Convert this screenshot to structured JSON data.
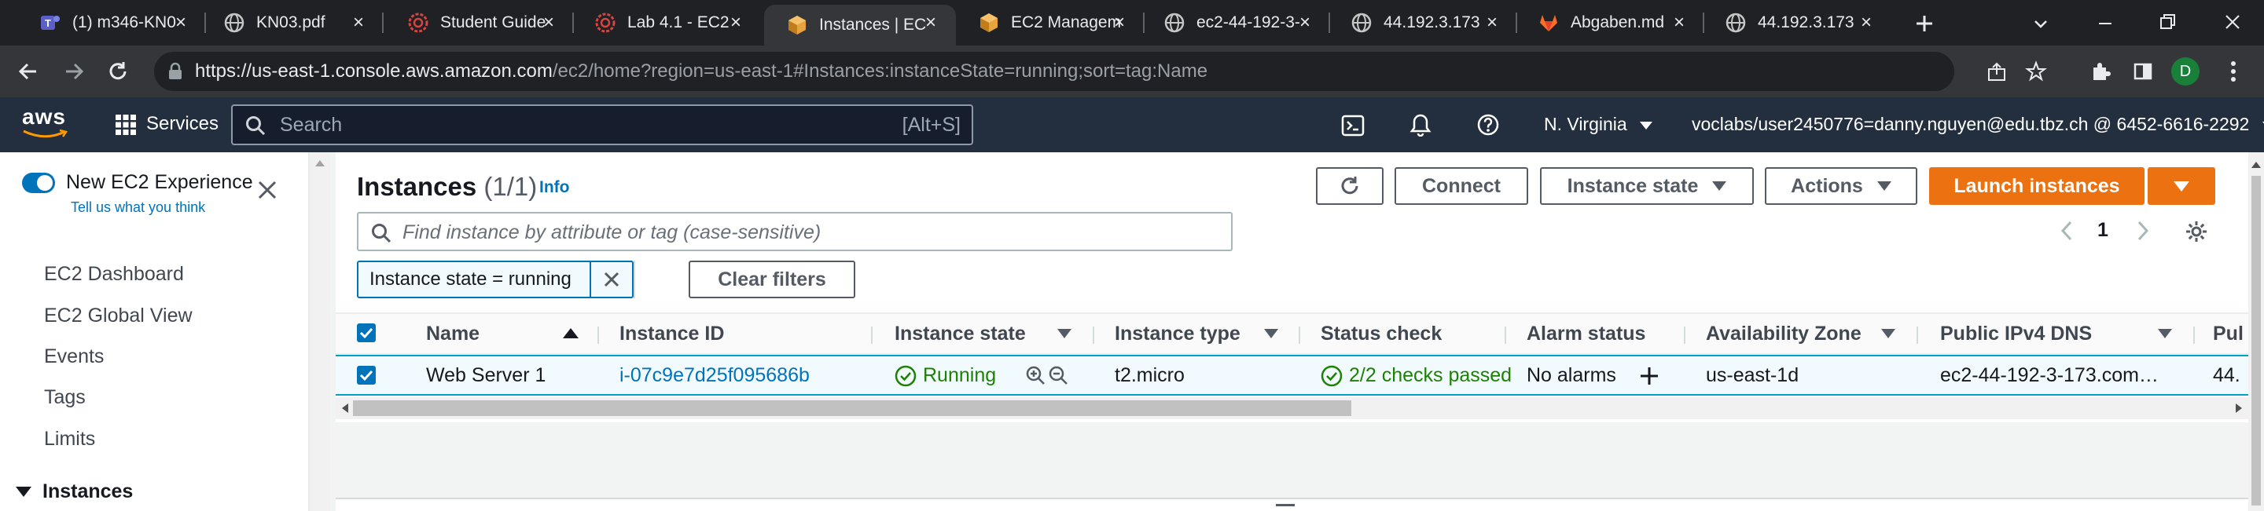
{
  "browser": {
    "tabs": [
      {
        "title": "(1) m346-KN0",
        "icon": "teams-icon",
        "active": false
      },
      {
        "title": "KN03.pdf",
        "icon": "globe-icon",
        "active": false
      },
      {
        "title": "Student Guide",
        "icon": "aws-academy-icon",
        "active": false
      },
      {
        "title": "Lab 4.1 - EC2",
        "icon": "aws-academy-icon",
        "active": false
      },
      {
        "title": "Instances | EC",
        "icon": "ec2-icon",
        "active": true
      },
      {
        "title": "EC2 Managem",
        "icon": "ec2-icon",
        "active": false
      },
      {
        "title": "ec2-44-192-3-",
        "icon": "globe-icon",
        "active": false
      },
      {
        "title": "44.192.3.173",
        "icon": "globe-icon",
        "active": false
      },
      {
        "title": "Abgaben.md",
        "icon": "gitlab-icon",
        "active": false
      },
      {
        "title": "44.192.3.173",
        "icon": "globe-icon",
        "active": false
      }
    ],
    "url_host": "https://us-east-1.console.aws.amazon.com",
    "url_path": "/ec2/home?region=us-east-1#Instances:instanceState=running;sort=tag:Name",
    "profile_initial": "D"
  },
  "aws_nav": {
    "logo": "aws",
    "services_label": "Services",
    "search_placeholder": "Search",
    "search_shortcut": "[Alt+S]",
    "region": "N. Virginia",
    "account": "voclabs/user2450776=danny.nguyen@edu.tbz.ch @ 6452-6616-2292"
  },
  "sidebar": {
    "toggle_label": "New EC2 Experience",
    "toggle_link": "Tell us what you think",
    "items": [
      "EC2 Dashboard",
      "EC2 Global View",
      "Events",
      "Tags",
      "Limits"
    ],
    "section": "Instances"
  },
  "instances": {
    "title": "Instances",
    "count": "(1/1)",
    "info": "Info",
    "buttons": {
      "connect": "Connect",
      "instance_state": "Instance state",
      "actions": "Actions",
      "launch": "Launch instances"
    },
    "filter_placeholder": "Find instance by attribute or tag (case-sensitive)",
    "active_filter": "Instance state = running",
    "clear_filters": "Clear filters",
    "page": "1",
    "columns": [
      "Name",
      "Instance ID",
      "Instance state",
      "Instance type",
      "Status check",
      "Alarm status",
      "Availability Zone",
      "Public IPv4 DNS",
      "Pul"
    ],
    "row": {
      "name": "Web Server 1",
      "instance_id": "i-07c9e7d25f095686b",
      "state": "Running",
      "type": "t2.micro",
      "status_check": "2/2 checks passed",
      "alarm": "No alarms",
      "az": "us-east-1d",
      "dns": "ec2-44-192-3-173.com…",
      "public_ip": "44."
    }
  },
  "colors": {
    "aws_nav": "#232f3e",
    "accent_orange": "#ec7211",
    "link_blue": "#0073bb",
    "success_green": "#1d8102"
  }
}
